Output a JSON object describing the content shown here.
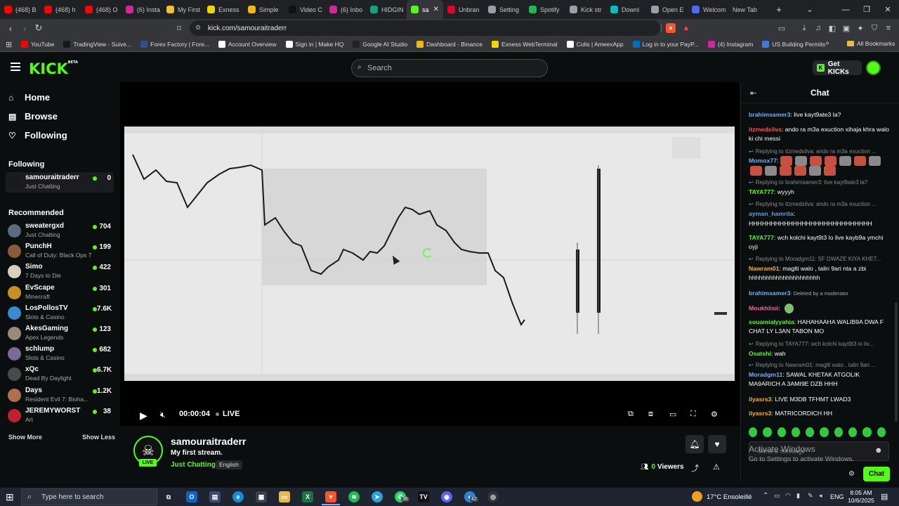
{
  "browser": {
    "tabs": [
      {
        "label": "(468) B",
        "icon": "youtube-icon",
        "color": "#ff0000"
      },
      {
        "label": "(468) h",
        "icon": "youtube-icon",
        "color": "#ff0000"
      },
      {
        "label": "(468) O",
        "icon": "youtube-icon",
        "color": "#ff0000"
      },
      {
        "label": "(6) Insta",
        "icon": "instagram-icon",
        "color": "#d6249f"
      },
      {
        "label": "My First",
        "icon": "chrome-icon",
        "color": "#f0c030"
      },
      {
        "label": "Exness",
        "icon": "exness-icon",
        "color": "#f2d600"
      },
      {
        "label": "Simple",
        "icon": "binance-icon",
        "color": "#f0b90b"
      },
      {
        "label": "Video C",
        "icon": "tiktok-icon",
        "color": "#111111"
      },
      {
        "label": "(6) Inbo",
        "icon": "instagram-icon",
        "color": "#d6249f"
      },
      {
        "label": "HIDGIN",
        "icon": "chatgpt-icon",
        "color": "#10a37f"
      },
      {
        "label": "sa",
        "icon": "kick-icon",
        "color": "#53fc18"
      },
      {
        "label": "Unbran",
        "icon": "pinterest-icon",
        "color": "#e60023"
      },
      {
        "label": "Setting",
        "icon": "gear-icon",
        "color": "#9aa0a6"
      },
      {
        "label": "Spotify",
        "icon": "spotify-icon",
        "color": "#1db954"
      },
      {
        "label": "Kick str",
        "icon": "gear-icon",
        "color": "#9aa0a6"
      },
      {
        "label": "Downl",
        "icon": "download-icon",
        "color": "#00c0c0"
      },
      {
        "label": "Open E",
        "icon": "globe-icon",
        "color": "#9aa0a6"
      },
      {
        "label": "Welcom",
        "icon": "welcome-icon",
        "color": "#4a6cf7"
      },
      {
        "label": "New Tab",
        "icon": "newtab-icon",
        "color": "#202124"
      }
    ],
    "url": "kick.com/samouraitraderr",
    "bookmarks": [
      {
        "label": "YouTube",
        "color": "#ff0000"
      },
      {
        "label": "TradingView - Suive...",
        "color": "#131722"
      },
      {
        "label": "Forex Factory | Fore...",
        "color": "#2f4f8f"
      },
      {
        "label": "Account Overview",
        "color": "#ffffff"
      },
      {
        "label": "Sign in | Make HQ",
        "color": "#ffffff"
      },
      {
        "label": "Google AI Studio",
        "color": "#222222"
      },
      {
        "label": "Dashboard - Binance",
        "color": "#f0b90b"
      },
      {
        "label": "Exness WebTerminal",
        "color": "#f2d600"
      },
      {
        "label": "Colis | AmeexApp",
        "color": "#ffffff"
      },
      {
        "label": "Log in to your PayP...",
        "color": "#0070ba"
      },
      {
        "label": "(4) Instagram",
        "color": "#d6249f"
      },
      {
        "label": "US Building Permits",
        "color": "#3d7bd9"
      }
    ],
    "all_bookmarks": "All Bookmarks",
    "extension_badge": "2"
  },
  "kick": {
    "logo": "KICK",
    "logo_tag": "BETA",
    "search_placeholder": "Search",
    "get_kicks": "Get KICKs",
    "brand_color": "#53fc18"
  },
  "sidebar": {
    "nav": [
      {
        "label": "Home",
        "icon": "home-icon"
      },
      {
        "label": "Browse",
        "icon": "browse-icon"
      },
      {
        "label": "Following",
        "icon": "heart-icon"
      }
    ],
    "following_header": "Following",
    "following": [
      {
        "name": "samouraitraderr",
        "sub": "Just Chatting",
        "viewers": "0",
        "color": "#1a1a1a"
      }
    ],
    "recommended_header": "Recommended",
    "recommended": [
      {
        "name": "sweatergxd",
        "sub": "Just Chatting",
        "viewers": "704",
        "color": "#5a6b7c"
      },
      {
        "name": "PunchH",
        "sub": "Call of Duty: Black Ops 7",
        "viewers": "199",
        "color": "#8a5a3c"
      },
      {
        "name": "Simo",
        "sub": "7 Days to Die",
        "viewers": "422",
        "color": "#d8d0c0"
      },
      {
        "name": "EvScape",
        "sub": "Minecraft",
        "viewers": "301",
        "color": "#c89020"
      },
      {
        "name": "LosPollosTV",
        "sub": "Slots & Casino",
        "viewers": "7.6K",
        "color": "#3a8ad0"
      },
      {
        "name": "AkesGaming",
        "sub": "Apex Legends",
        "viewers": "123",
        "color": "#9a8a7a"
      },
      {
        "name": "schlump",
        "sub": "Slots & Casino",
        "viewers": "682",
        "color": "#7a6a9a"
      },
      {
        "name": "xQc",
        "sub": "Dead By Daylight",
        "viewers": "6.7K",
        "color": "#4a4a4a"
      },
      {
        "name": "Days",
        "sub": "Resident Evil 7: Bioha...",
        "viewers": "1.2K",
        "color": "#b07050"
      },
      {
        "name": "JEREMYWORST",
        "sub": "Art",
        "viewers": "38",
        "color": "#c02030"
      }
    ],
    "show_more": "Show More",
    "show_less": "Show Less"
  },
  "player": {
    "time": "00:00:04",
    "live": "LIVE"
  },
  "stream": {
    "channel": "samouraitraderr",
    "title": "My first stream.",
    "category": "Just Chatting",
    "language": "English",
    "live_badge": "LIVE",
    "viewers_count": "0",
    "viewers_label": "Viewers"
  },
  "chat": {
    "title": "Chat",
    "messages": [
      {
        "kind": "msg",
        "user": "brahimsamer3",
        "ucolor": "#6ab0ff",
        "text": ": live kayt9ate3 la?"
      },
      {
        "kind": "msg",
        "user": "itzmedsilva",
        "ucolor": "#ff5050",
        "text": ": ando ra m3a exuction xihaja khra walo ki chi messi"
      },
      {
        "kind": "reply",
        "text": "Replying to itzmedsilva: ando ra m3a exuction ..."
      },
      {
        "kind": "emotes",
        "user": "Momox77",
        "ucolor": "#6ab0ff",
        "text": ":"
      },
      {
        "kind": "reply",
        "text": "Replying to brahimsamer3: live kayt9ate3 la?"
      },
      {
        "kind": "msg",
        "user": "TAYA777",
        "ucolor": "#53fc18",
        "text": ": wyyyh"
      },
      {
        "kind": "reply",
        "text": "Replying to itzmedsilva: ando ra m3a exuction ..."
      },
      {
        "kind": "msg",
        "user": "ayman_hamrita",
        "ucolor": "#5aa0e0",
        "text": ":"
      },
      {
        "kind": "msg",
        "user": "",
        "ucolor": "#ffffff",
        "text": "HHHHHHHHHHHHHHHHHHHHHHHHHHHH"
      },
      {
        "kind": "msg",
        "user": "TAYA777",
        "ucolor": "#53fc18",
        "text": ": wch kolchi kayt9t3 lo live kayb9a ymchi oyji"
      },
      {
        "kind": "reply",
        "text": "Replying to Moradgm11: SF DWAZE KIYA KHET..."
      },
      {
        "kind": "msg",
        "user": "Nawram01",
        "ucolor": "#ffb020",
        "text": ": maglti walo , talin 9ari nta a zbi hhhhhhhhhhhhhhhhhhhhh"
      },
      {
        "kind": "msg",
        "user": "brahimsamer3",
        "ucolor": "#6ab0ff",
        "text": ": Deleted by a moderator",
        "deleted": true
      },
      {
        "kind": "msg",
        "user": "Moukhlisii",
        "ucolor": "#ff60a0",
        "text": ":"
      },
      {
        "kind": "msg",
        "user": "souamialyyahia",
        "ucolor": "#53fc18",
        "text": ": HAHAHAAHA WALIB9A DWA F CHAT LY L3AN TABON MO"
      },
      {
        "kind": "reply",
        "text": "Replying to TAYA777: wch kolchi kayt9t3 lo liv..."
      },
      {
        "kind": "msg",
        "user": "Osatshi",
        "ucolor": "#53fc18",
        "text": ": wah"
      },
      {
        "kind": "reply",
        "text": "Replying to Nawram01: maglti walo , talin 9ari ..."
      },
      {
        "kind": "msg",
        "user": "Moradgm11",
        "ucolor": "#6ab0ff",
        "text": ": SAWAL KHETAK ATGOLIK MA9ARICH A 3AMI9E DZB HHH"
      },
      {
        "kind": "msg",
        "user": "ilyasrs3",
        "ucolor": "#ffb020",
        "text": ": LIVE M3DB TFHMT LWAD3"
      },
      {
        "kind": "msg",
        "user": "ilyasrs3",
        "ucolor": "#ffb020",
        "text": ": MATRICORDICH HH"
      }
    ],
    "input_placeholder": "Send a message",
    "send_label": "Chat",
    "watermark_line1": "Activate Windows",
    "watermark_line2": "Go to Settings to activate Windows."
  },
  "taskbar": {
    "search": "Type here to search",
    "weather": "17°C  Ensoleillé",
    "lang": "ENG",
    "time": "8:05 AM",
    "date": "10/6/2025",
    "badge_whatsapp": "36",
    "badge_discord": "42"
  }
}
